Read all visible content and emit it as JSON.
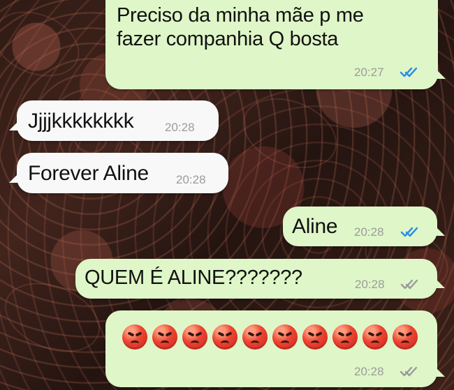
{
  "chat": {
    "messages": [
      {
        "direction": "outgoing",
        "text": "Preciso da minha mãe p me\nfazer companhia Q bosta",
        "time": "20:27",
        "status_icon": "double-check-read-icon",
        "status_color": "#2f8ee5"
      },
      {
        "direction": "incoming",
        "text": "Jjjjkkkkkkkk",
        "time": "20:28"
      },
      {
        "direction": "incoming",
        "text": "Forever Aline",
        "time": "20:28"
      },
      {
        "direction": "outgoing",
        "text": "Aline",
        "time": "20:28",
        "status_icon": "double-check-read-icon",
        "status_color": "#2f8ee5"
      },
      {
        "direction": "outgoing",
        "text": "QUEM É ALINE???????",
        "time": "20:28",
        "status_icon": "double-check-delivered-icon",
        "status_color": "#999999"
      },
      {
        "direction": "outgoing",
        "emoji_icon": "angry-face-icon",
        "emoji_count": 10,
        "time": "20:28",
        "status_icon": "double-check-delivered-icon",
        "status_color": "#999999"
      }
    ]
  },
  "colors": {
    "outgoing_bubble": "#dff6c8",
    "incoming_bubble": "#f8f8f8",
    "read_ticks": "#2f8ee5",
    "delivered_ticks": "#999999"
  }
}
